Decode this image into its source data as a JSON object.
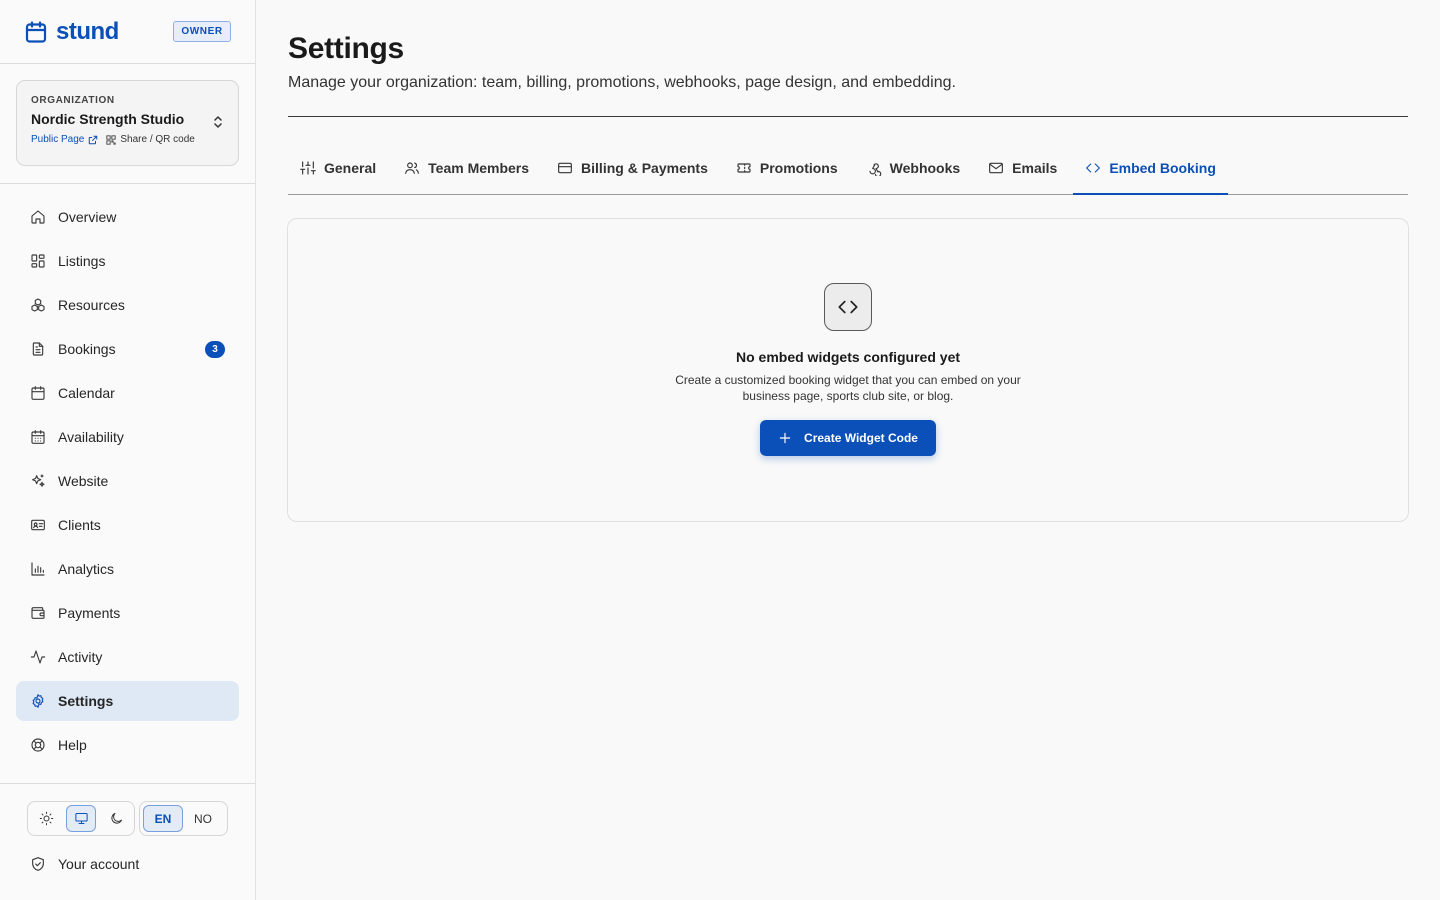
{
  "brand": {
    "name": "stund",
    "role_badge": "OWNER"
  },
  "organization": {
    "label": "ORGANIZATION",
    "name": "Nordic Strength Studio",
    "public_page_link": "Public Page",
    "share_link": "Share / QR code"
  },
  "sidebar": {
    "items": [
      {
        "label": "Overview",
        "icon": "home-icon"
      },
      {
        "label": "Listings",
        "icon": "grid-icon"
      },
      {
        "label": "Resources",
        "icon": "boxes-icon"
      },
      {
        "label": "Bookings",
        "icon": "file-text-icon",
        "badge": "3"
      },
      {
        "label": "Calendar",
        "icon": "calendar-icon"
      },
      {
        "label": "Availability",
        "icon": "calendar-days-icon"
      },
      {
        "label": "Website",
        "icon": "sparkles-icon"
      },
      {
        "label": "Clients",
        "icon": "id-card-icon"
      },
      {
        "label": "Analytics",
        "icon": "bar-chart-icon"
      },
      {
        "label": "Payments",
        "icon": "wallet-icon"
      },
      {
        "label": "Activity",
        "icon": "activity-icon"
      },
      {
        "label": "Settings",
        "icon": "gear-icon",
        "active": true
      },
      {
        "label": "Help",
        "icon": "life-buoy-icon"
      }
    ],
    "theme": {
      "options": [
        "light",
        "system",
        "dark"
      ],
      "selected": "system"
    },
    "language": {
      "options": [
        "EN",
        "NO"
      ],
      "selected": "EN"
    },
    "account_label": "Your account"
  },
  "page": {
    "title": "Settings",
    "subtitle": "Manage your organization: team, billing, promotions, webhooks, page design, and embedding."
  },
  "tabs": [
    {
      "label": "General",
      "icon": "sliders-icon"
    },
    {
      "label": "Team Members",
      "icon": "users-icon"
    },
    {
      "label": "Billing & Payments",
      "icon": "credit-card-icon"
    },
    {
      "label": "Promotions",
      "icon": "ticket-icon"
    },
    {
      "label": "Webhooks",
      "icon": "webhook-icon"
    },
    {
      "label": "Emails",
      "icon": "mail-icon"
    },
    {
      "label": "Embed Booking",
      "icon": "code-icon",
      "active": true
    }
  ],
  "empty_state": {
    "title": "No embed widgets configured yet",
    "description": "Create a customized booking widget that you can embed on your business page, sports club site, or blog.",
    "button_label": "Create Widget Code"
  },
  "colors": {
    "accent": "#0b4fb8",
    "active_nav_bg": "#dfe8f5",
    "page_bg": "#f9f9f9"
  }
}
